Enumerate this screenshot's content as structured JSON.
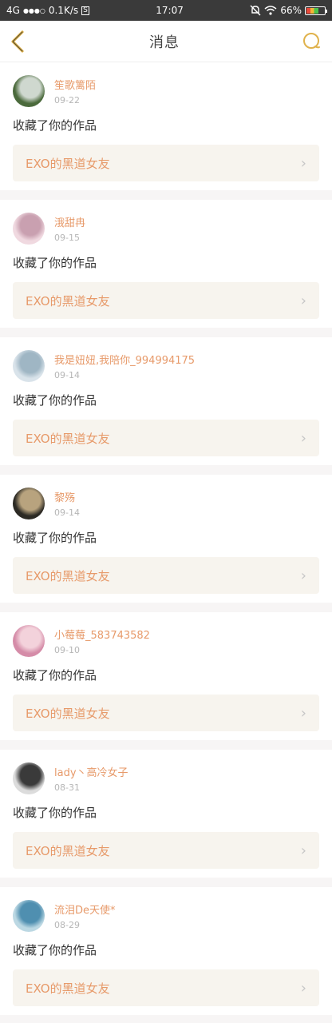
{
  "statusbar": {
    "network": "4G",
    "signal": "●●●○",
    "speed": "0.1K/s",
    "s_badge": "S",
    "time": "17:07",
    "battery_pct": "66%"
  },
  "navbar": {
    "title": "消息",
    "back_icon": "chevron-left-icon",
    "search_icon": "search-icon",
    "accent": "#e0b24c"
  },
  "feed": [
    {
      "name": "笙歌篱陌",
      "date": "09-22",
      "action": "收藏了你的作品",
      "work": "EXO的黑道女友",
      "avatar_colors": [
        "#4b6a3c",
        "#cfd8cf"
      ]
    },
    {
      "name": "涐甜冉",
      "date": "09-15",
      "action": "收藏了你的作品",
      "work": "EXO的黑道女友",
      "avatar_colors": [
        "#f0d9e0",
        "#c9a0b0"
      ]
    },
    {
      "name": "我是妞妞,我陪你_994994175",
      "date": "09-14",
      "action": "收藏了你的作品",
      "work": "EXO的黑道女友",
      "avatar_colors": [
        "#d9e3ea",
        "#9fb6c4"
      ]
    },
    {
      "name": "黎殇",
      "date": "09-14",
      "action": "收藏了你的作品",
      "work": "EXO的黑道女友",
      "avatar_colors": [
        "#2c2a24",
        "#b8a37e"
      ]
    },
    {
      "name": "小莓莓_583743582",
      "date": "09-10",
      "action": "收藏了你的作品",
      "work": "EXO的黑道女友",
      "avatar_colors": [
        "#d58ca8",
        "#f3d2db"
      ]
    },
    {
      "name": "lady丶高冷女子",
      "date": "08-31",
      "action": "收藏了你的作品",
      "work": "EXO的黑道女友",
      "avatar_colors": [
        "#dcdcdc",
        "#3a3a3a"
      ]
    },
    {
      "name": "流泪De天使*",
      "date": "08-29",
      "action": "收藏了你的作品",
      "work": "EXO的黑道女友",
      "avatar_colors": [
        "#bcd8e3",
        "#4f8fb0"
      ]
    }
  ],
  "colors": {
    "username": "#e79a6a",
    "date": "#b6b6b6",
    "work_bg": "#f7f4ee"
  }
}
